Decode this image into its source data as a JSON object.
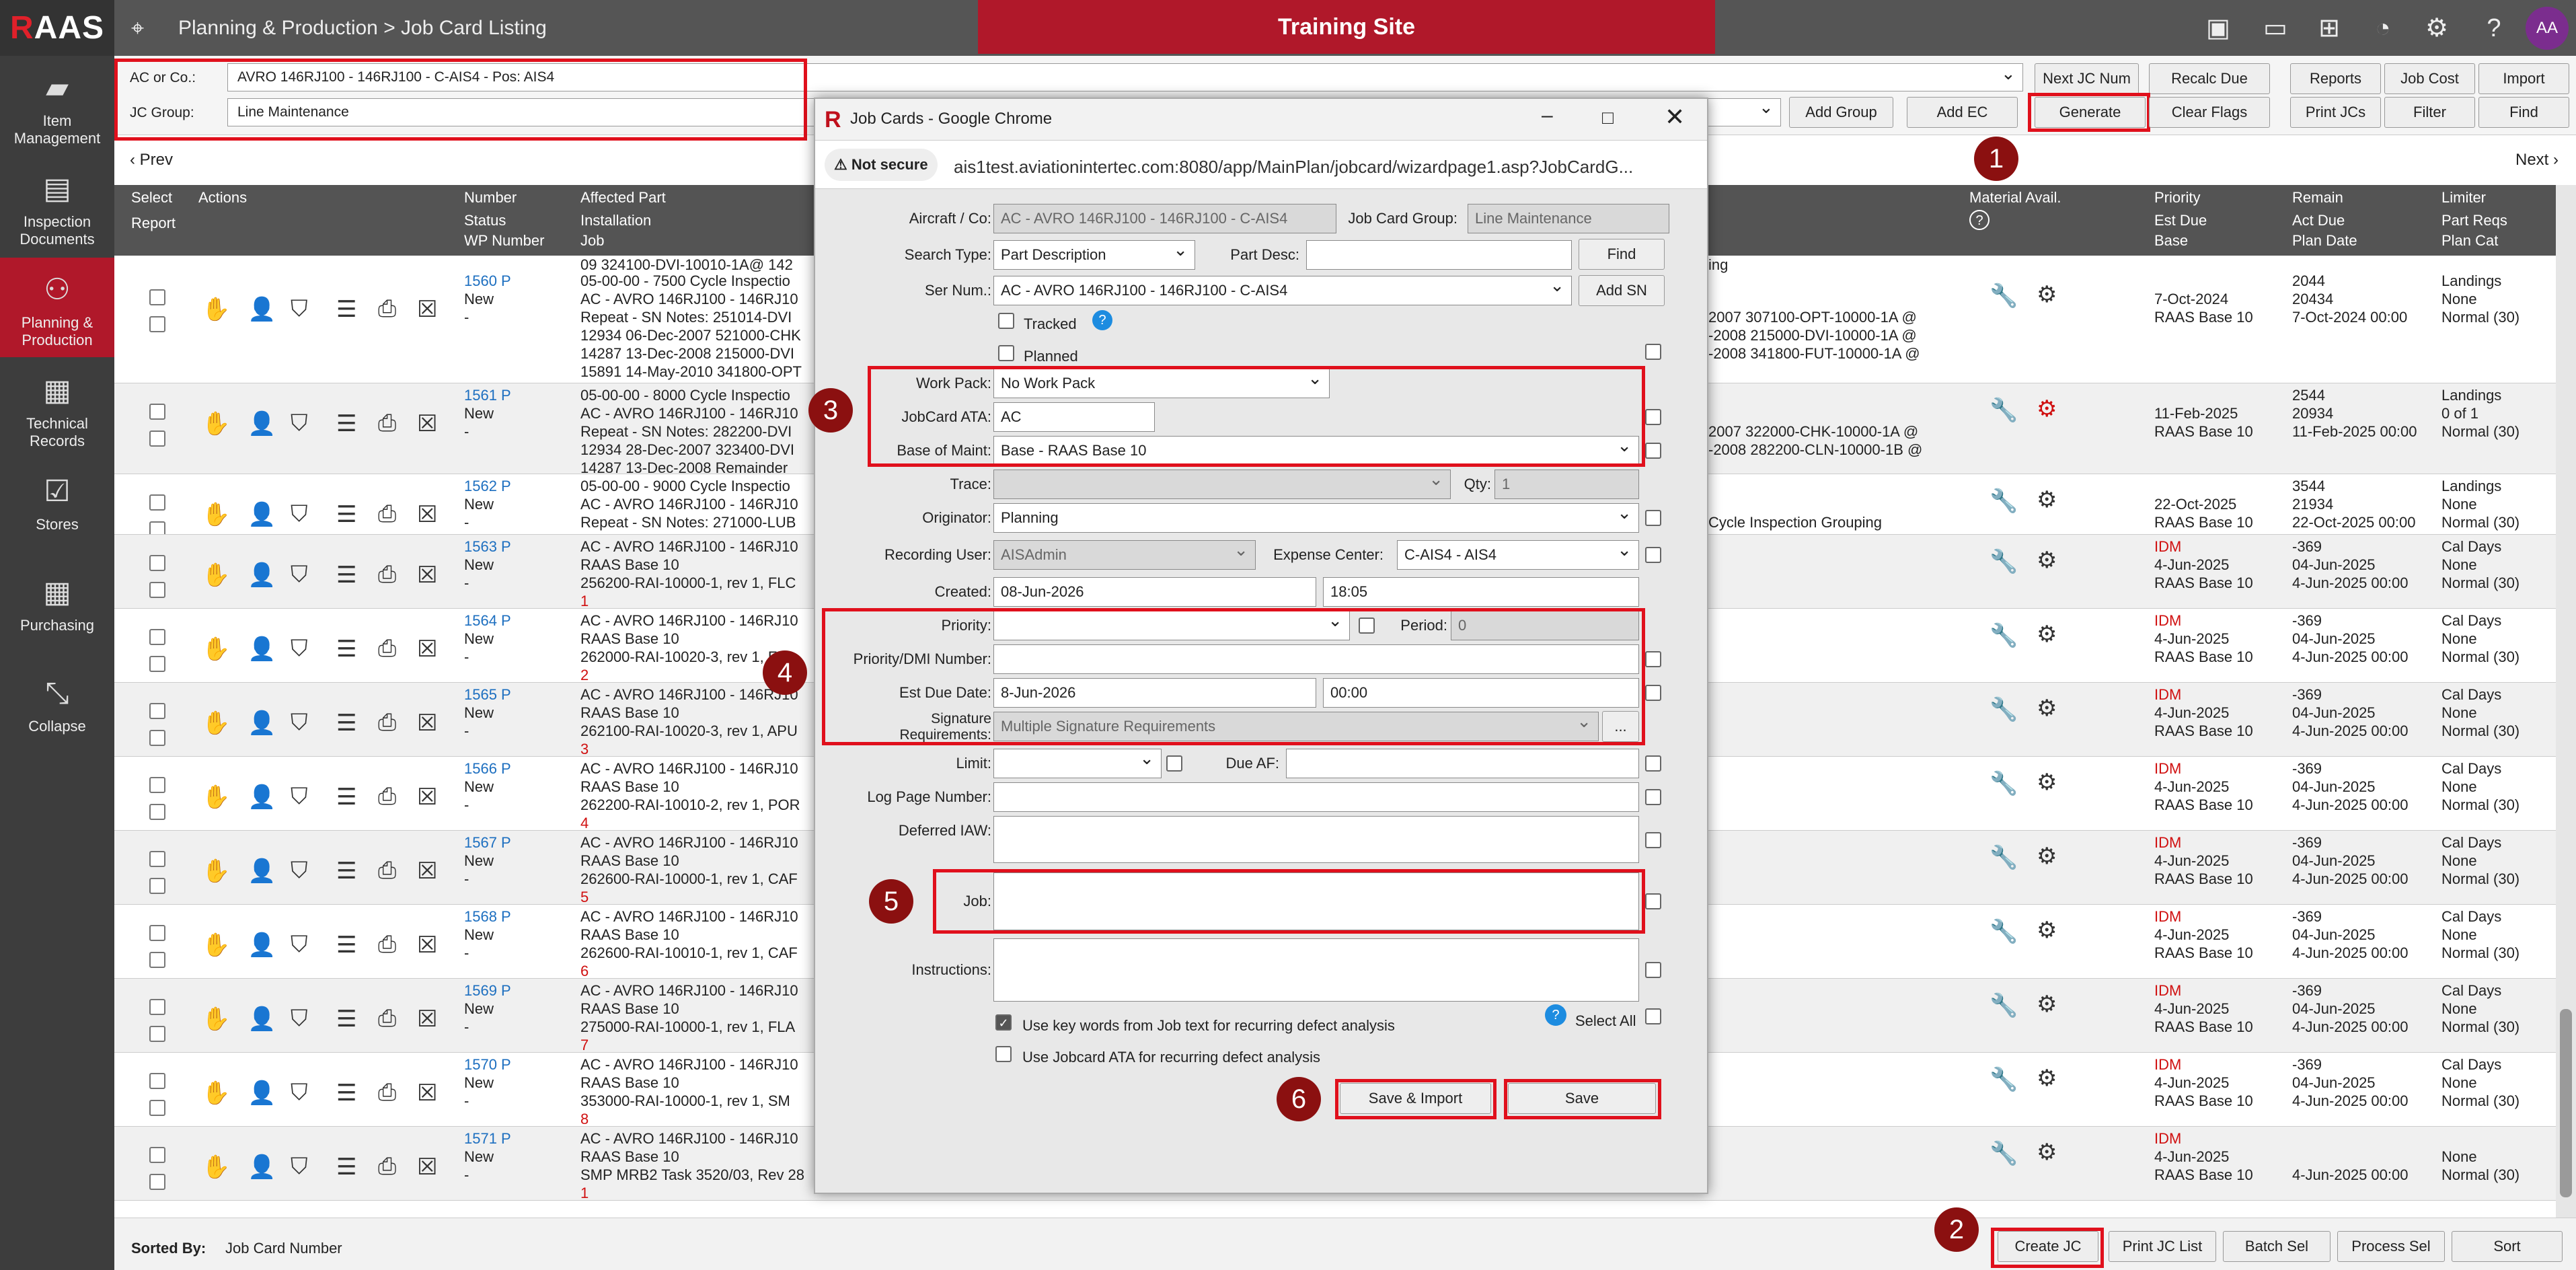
{
  "app": {
    "logo_r": "R",
    "logo_rest": "AAS",
    "breadcrumb": "Planning & Production > Job Card Listing",
    "banner": "Training Site",
    "avatar": "AA"
  },
  "sidebar": {
    "items": [
      {
        "label": "Item Management",
        "icon": "folder-icon"
      },
      {
        "label": "Inspection Documents",
        "icon": "document-icon"
      },
      {
        "label": "Planning & Production",
        "icon": "network-icon"
      },
      {
        "label": "Technical Records",
        "icon": "chart-icon"
      },
      {
        "label": "Stores",
        "icon": "clipboard-icon"
      },
      {
        "label": "Purchasing",
        "icon": "calculator-icon"
      },
      {
        "label": "Collapse",
        "icon": "collapse-icon"
      }
    ]
  },
  "filters": {
    "ac_label": "AC or Co.:",
    "ac_value": "AVRO 146RJ100 - 146RJ100 - C-AIS4 - Pos: AIS4",
    "group_label": "JC Group:",
    "group_value": "Line Maintenance",
    "buttons_row1": [
      "Next JC Num",
      "Recalc Due",
      "Reports",
      "Job Cost",
      "Import"
    ],
    "buttons_row2": [
      "Add Group",
      "Add EC",
      "Generate",
      "Clear Flags",
      "Print JCs",
      "Filter",
      "Find"
    ],
    "prev": "‹ Prev",
    "next": "Next ›"
  },
  "table": {
    "headers": {
      "select": "Select",
      "actions": "Actions",
      "report": "Report",
      "number": "Number",
      "status": "Status",
      "wp": "WP Number",
      "affected": "Affected Part",
      "installation": "Installation",
      "job": "Job",
      "material": "Material Avail.",
      "material_q": "?",
      "priority": "Priority",
      "est_due": "Est Due",
      "base": "Base",
      "remain": "Remain",
      "act_due": "Act Due",
      "plan_date": "Plan Date",
      "limiter": "Limiter",
      "part_reqs": "Part Reqs",
      "plan_cat": "Plan Cat"
    },
    "top_partial": {
      "job": "09 324100-DVI-10010-1A@ 142",
      "right": "ing"
    },
    "rows": [
      {
        "number": "1560 P",
        "status": "New",
        "wp": "-",
        "lines": [
          "05-00-00 - 7500 Cycle Inspectio",
          "AC - AVRO 146RJ100 - 146RJ10",
          "Repeat - SN Notes: 251014-DVI",
          "12934 06-Dec-2007 521000-CHK",
          "14287 13-Dec-2008 215000-DVI",
          "15891 14-May-2010 341800-OPT"
        ],
        "mid": [
          "",
          "",
          "2007 307100-OPT-10000-1A @",
          "-2008 215000-DVI-10000-1A @",
          "-2008 341800-FUT-10000-1A @"
        ],
        "priority": "",
        "est_due": "7-Oct-2024",
        "base": "RAAS Base 10",
        "remain": "2044",
        "act_due": "20434",
        "plan_date": "7-Oct-2024 00:00",
        "limiter": "Landings",
        "part_reqs": "None",
        "plan_cat": "Normal (30)",
        "gear_red": false
      },
      {
        "number": "1561 P",
        "status": "New",
        "wp": "-",
        "lines": [
          "05-00-00 - 8000 Cycle Inspectio",
          "AC - AVRO 146RJ100 - 146RJ10",
          "Repeat - SN Notes: 282200-DVI",
          "12934 28-Dec-2007 323400-DVI",
          "14287 13-Dec-2008 Remainder"
        ],
        "mid": [
          "",
          "",
          "2007 322000-CHK-10000-1A @",
          "-2008 282200-CLN-10000-1B @"
        ],
        "priority": "",
        "est_due": "11-Feb-2025",
        "base": "RAAS Base 10",
        "remain": "2544",
        "act_due": "20934",
        "plan_date": "11-Feb-2025 00:00",
        "limiter": "Landings",
        "part_reqs": "0 of 1",
        "plan_cat": "Normal (30)",
        "gear_red": true
      },
      {
        "number": "1562 P",
        "status": "New",
        "wp": "-",
        "lines": [
          "05-00-00 - 9000 Cycle Inspectio",
          "AC - AVRO 146RJ100 - 146RJ10",
          "Repeat - SN Notes: 271000-LUB"
        ],
        "mid": [
          "",
          "",
          "Cycle Inspection Grouping"
        ],
        "priority": "",
        "est_due": "22-Oct-2025",
        "base": "RAAS Base 10",
        "remain": "3544",
        "act_due": "21934",
        "plan_date": "22-Oct-2025 00:00",
        "limiter": "Landings",
        "part_reqs": "None",
        "plan_cat": "Normal (30)",
        "gear_red": false
      },
      {
        "number": "1563 P",
        "status": "New",
        "wp": "-",
        "lines": [
          "AC - AVRO 146RJ100 - 146RJ10",
          "RAAS Base 10",
          "256200-RAI-10000-1, rev 1, FLC"
        ],
        "redline": "1",
        "mid": [],
        "priority": "IDM",
        "est_due": "4-Jun-2025",
        "base": "RAAS Base 10",
        "remain": "-369",
        "act_due": "04-Jun-2025",
        "plan_date": "4-Jun-2025 00:00",
        "limiter": "Cal Days",
        "part_reqs": "None",
        "plan_cat": "Normal (30)",
        "gear_red": false
      },
      {
        "number": "1564 P",
        "status": "New",
        "wp": "-",
        "lines": [
          "AC - AVRO 146RJ100 - 146RJ10",
          "RAAS Base 10",
          "262000-RAI-10020-3, rev 1, FIR"
        ],
        "redline": "2",
        "mid": [],
        "priority": "IDM",
        "est_due": "4-Jun-2025",
        "base": "RAAS Base 10",
        "remain": "-369",
        "act_due": "04-Jun-2025",
        "plan_date": "4-Jun-2025 00:00",
        "limiter": "Cal Days",
        "part_reqs": "None",
        "plan_cat": "Normal (30)",
        "gear_red": false
      },
      {
        "number": "1565 P",
        "status": "New",
        "wp": "-",
        "lines": [
          "AC - AVRO 146RJ100 - 146RJ10",
          "RAAS Base 10",
          "262100-RAI-10020-3, rev 1, APU"
        ],
        "redline": "3",
        "mid": [],
        "priority": "IDM",
        "est_due": "4-Jun-2025",
        "base": "RAAS Base 10",
        "remain": "-369",
        "act_due": "04-Jun-2025",
        "plan_date": "4-Jun-2025 00:00",
        "limiter": "Cal Days",
        "part_reqs": "None",
        "plan_cat": "Normal (30)",
        "gear_red": false
      },
      {
        "number": "1566 P",
        "status": "New",
        "wp": "-",
        "lines": [
          "AC - AVRO 146RJ100 - 146RJ10",
          "RAAS Base 10",
          "262200-RAI-10010-2, rev 1, POR"
        ],
        "redline": "4",
        "mid": [],
        "priority": "IDM",
        "est_due": "4-Jun-2025",
        "base": "RAAS Base 10",
        "remain": "-369",
        "act_due": "04-Jun-2025",
        "plan_date": "4-Jun-2025 00:00",
        "limiter": "Cal Days",
        "part_reqs": "None",
        "plan_cat": "Normal (30)",
        "gear_red": false
      },
      {
        "number": "1567 P",
        "status": "New",
        "wp": "-",
        "lines": [
          "AC - AVRO 146RJ100 - 146RJ10",
          "RAAS Base 10",
          "262600-RAI-10000-1, rev 1, CAF"
        ],
        "redline": "5",
        "mid": [],
        "priority": "IDM",
        "est_due": "4-Jun-2025",
        "base": "RAAS Base 10",
        "remain": "-369",
        "act_due": "04-Jun-2025",
        "plan_date": "4-Jun-2025 00:00",
        "limiter": "Cal Days",
        "part_reqs": "None",
        "plan_cat": "Normal (30)",
        "gear_red": false
      },
      {
        "number": "1568 P",
        "status": "New",
        "wp": "-",
        "lines": [
          "AC - AVRO 146RJ100 - 146RJ10",
          "RAAS Base 10",
          "262600-RAI-10010-1, rev 1, CAF"
        ],
        "redline": "6",
        "mid": [],
        "priority": "IDM",
        "est_due": "4-Jun-2025",
        "base": "RAAS Base 10",
        "remain": "-369",
        "act_due": "04-Jun-2025",
        "plan_date": "4-Jun-2025 00:00",
        "limiter": "Cal Days",
        "part_reqs": "None",
        "plan_cat": "Normal (30)",
        "gear_red": false
      },
      {
        "number": "1569 P",
        "status": "New",
        "wp": "-",
        "lines": [
          "AC - AVRO 146RJ100 - 146RJ10",
          "RAAS Base 10",
          "275000-RAI-10000-1, rev 1, FLA"
        ],
        "redline": "7",
        "mid": [],
        "priority": "IDM",
        "est_due": "4-Jun-2025",
        "base": "RAAS Base 10",
        "remain": "-369",
        "act_due": "04-Jun-2025",
        "plan_date": "4-Jun-2025 00:00",
        "limiter": "Cal Days",
        "part_reqs": "None",
        "plan_cat": "Normal (30)",
        "gear_red": false
      },
      {
        "number": "1570 P",
        "status": "New",
        "wp": "-",
        "lines": [
          "AC - AVRO 146RJ100 - 146RJ10",
          "RAAS Base 10",
          "353000-RAI-10000-1, rev 1, SM"
        ],
        "redline": "8",
        "mid": [],
        "priority": "IDM",
        "est_due": "4-Jun-2025",
        "base": "RAAS Base 10",
        "remain": "-369",
        "act_due": "04-Jun-2025",
        "plan_date": "4-Jun-2025 00:00",
        "limiter": "Cal Days",
        "part_reqs": "None",
        "plan_cat": "Normal (30)",
        "gear_red": false
      },
      {
        "number": "1571 P",
        "status": "New",
        "wp": "-",
        "lines": [
          "AC - AVRO 146RJ100 - 146RJ10",
          "RAAS Base 10",
          "SMP MRB2 Task 3520/03, Rev 28"
        ],
        "redline": "1",
        "mid": [],
        "priority": "IDM",
        "est_due": "4-Jun-2025",
        "base": "RAAS Base 10",
        "remain": "",
        "act_due": "",
        "plan_date": "4-Jun-2025 00:00",
        "limiter": "",
        "part_reqs": "None",
        "plan_cat": "Normal (30)",
        "gear_red": false
      }
    ]
  },
  "modal": {
    "title": "Job Cards - Google Chrome",
    "not_secure": "Not secure",
    "url": "ais1test.aviationintertec.com:8080/app/MainPlan/jobcard/wizardpage1.asp?JobCardG...",
    "aircraft_label": "Aircraft / Co:",
    "aircraft_value": "AC - AVRO 146RJ100 - 146RJ100 - C-AIS4",
    "jcgroup_label": "Job Card Group:",
    "jcgroup_value": "Line Maintenance",
    "search_type_label": "Search Type:",
    "search_type_value": "Part Description",
    "part_desc_label": "Part Desc:",
    "part_desc_value": "",
    "find_btn": "Find",
    "ser_num_label": "Ser Num.:",
    "ser_num_value": "AC - AVRO 146RJ100 - 146RJ100 - C-AIS4",
    "add_sn_btn": "Add SN",
    "tracked_label": "Tracked",
    "planned_label": "Planned",
    "help": "?",
    "work_pack_label": "Work Pack:",
    "work_pack_value": "No Work Pack",
    "ata_label": "JobCard ATA:",
    "ata_value": "AC",
    "base_label": "Base of Maint:",
    "base_value": "Base - RAAS Base 10",
    "trace_label": "Trace:",
    "trace_value": "",
    "qty_label": "Qty:",
    "qty_value": "1",
    "originator_label": "Originator:",
    "originator_value": "Planning",
    "rec_user_label": "Recording User:",
    "rec_user_value": "AISAdmin",
    "expense_label": "Expense Center:",
    "expense_value": "C-AIS4 - AIS4",
    "created_label": "Created:",
    "created_date": "08-Jun-2026",
    "created_time": "18:05",
    "priority_label": "Priority:",
    "priority_value": "",
    "period_label": "Period:",
    "period_value": "0",
    "dmi_label": "Priority/DMI Number:",
    "dmi_value": "",
    "est_due_label": "Est Due Date:",
    "est_due_date": "8-Jun-2026",
    "est_due_time": "00:00",
    "sig_label_1": "Signature",
    "sig_label_2": "Requirements:",
    "sig_value": "Multiple Signature Requirements",
    "sig_btn": "...",
    "limit_label": "Limit:",
    "limit_value": "",
    "due_af_label": "Due AF:",
    "due_af_value": "",
    "log_page_label": "Log Page Number:",
    "log_page_value": "",
    "deferred_label": "Deferred IAW:",
    "deferred_value": "",
    "job_label": "Job:",
    "job_value": "",
    "instructions_label": "Instructions:",
    "instructions_value": "",
    "kw_label": "Use key words from Job text for recurring defect analysis",
    "ata_use_label": "Use Jobcard ATA for recurring defect analysis",
    "select_all": "Select All",
    "save_import": "Save & Import",
    "save": "Save"
  },
  "markers": [
    "1",
    "2",
    "3",
    "4",
    "5",
    "6"
  ],
  "footer": {
    "sorted_label": "Sorted By:",
    "sorted_value": "Job Card Number",
    "buttons": [
      "Create JC",
      "Print JC List",
      "Batch Sel",
      "Process Sel",
      "Sort"
    ]
  },
  "colors": {
    "brand_red": "#b0182a",
    "annotation_red": "#e0101c",
    "marker": "#8b1010",
    "link": "#1d6fc0",
    "avatar": "#7b2d8e"
  }
}
